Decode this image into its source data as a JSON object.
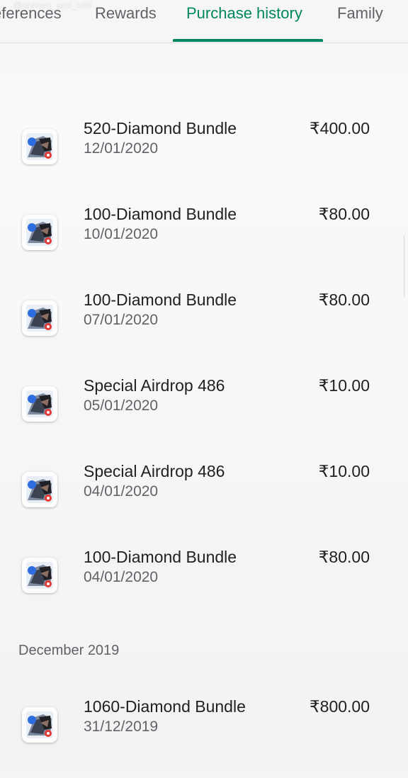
{
  "watermark": "@shivam_and_k66",
  "tabs": [
    {
      "label": "eferences"
    },
    {
      "label": "Rewards"
    },
    {
      "label": "Purchase history",
      "active": true
    },
    {
      "label": "Family"
    }
  ],
  "accent_color": "#01875f",
  "app_icon": "free-fire-game-icon",
  "purchases": [
    {
      "title": "520-Diamond Bundle",
      "date": "12/01/2020",
      "price": "₹400.00"
    },
    {
      "title": "100-Diamond Bundle",
      "date": "10/01/2020",
      "price": "₹80.00"
    },
    {
      "title": "100-Diamond Bundle",
      "date": "07/01/2020",
      "price": "₹80.00"
    },
    {
      "title": "Special Airdrop 486",
      "date": "05/01/2020",
      "price": "₹10.00"
    },
    {
      "title": "Special Airdrop 486",
      "date": "04/01/2020",
      "price": "₹10.00"
    },
    {
      "title": "100-Diamond Bundle",
      "date": "04/01/2020",
      "price": "₹80.00"
    }
  ],
  "sections": [
    {
      "header": "December 2019",
      "purchases": [
        {
          "title": "1060-Diamond Bundle",
          "date": "31/12/2019",
          "price": "₹800.00"
        }
      ]
    }
  ]
}
